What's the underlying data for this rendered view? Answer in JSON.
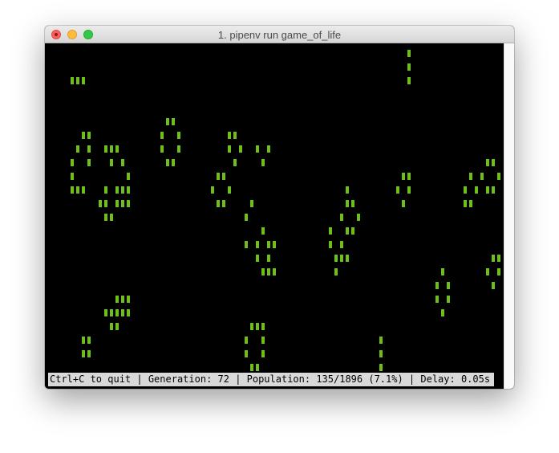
{
  "window": {
    "title": "1. pipenv run game_of_life"
  },
  "status": {
    "text": "Ctrl+C to quit | Generation: 72 | Population: 135/1896 (7.1%) | Delay: 0.05s"
  },
  "colors": {
    "cell": "#6fbf1a",
    "terminal_background": "#000000",
    "status_background": "#d9d9d9"
  },
  "grid": {
    "columns": 79,
    "rows": 24,
    "live_cells": [
      [
        62,
        0
      ],
      [
        62,
        1
      ],
      [
        2,
        2
      ],
      [
        3,
        2
      ],
      [
        4,
        2
      ],
      [
        62,
        2
      ],
      [
        19,
        5
      ],
      [
        20,
        5
      ],
      [
        4,
        6
      ],
      [
        5,
        6
      ],
      [
        18,
        6
      ],
      [
        21,
        6
      ],
      [
        30,
        6
      ],
      [
        31,
        6
      ],
      [
        3,
        7
      ],
      [
        5,
        7
      ],
      [
        8,
        7
      ],
      [
        9,
        7
      ],
      [
        10,
        7
      ],
      [
        18,
        7
      ],
      [
        21,
        7
      ],
      [
        30,
        7
      ],
      [
        32,
        7
      ],
      [
        35,
        7
      ],
      [
        37,
        7
      ],
      [
        2,
        8
      ],
      [
        5,
        8
      ],
      [
        9,
        8
      ],
      [
        11,
        8
      ],
      [
        19,
        8
      ],
      [
        20,
        8
      ],
      [
        31,
        8
      ],
      [
        36,
        8
      ],
      [
        76,
        8
      ],
      [
        77,
        8
      ],
      [
        2,
        9
      ],
      [
        12,
        9
      ],
      [
        28,
        9
      ],
      [
        29,
        9
      ],
      [
        61,
        9
      ],
      [
        62,
        9
      ],
      [
        73,
        9
      ],
      [
        75,
        9
      ],
      [
        78,
        9
      ],
      [
        2,
        10
      ],
      [
        3,
        10
      ],
      [
        4,
        10
      ],
      [
        8,
        10
      ],
      [
        10,
        10
      ],
      [
        11,
        10
      ],
      [
        12,
        10
      ],
      [
        27,
        10
      ],
      [
        30,
        10
      ],
      [
        51,
        10
      ],
      [
        60,
        10
      ],
      [
        62,
        10
      ],
      [
        72,
        10
      ],
      [
        74,
        10
      ],
      [
        76,
        10
      ],
      [
        77,
        10
      ],
      [
        7,
        11
      ],
      [
        8,
        11
      ],
      [
        10,
        11
      ],
      [
        11,
        11
      ],
      [
        12,
        11
      ],
      [
        28,
        11
      ],
      [
        29,
        11
      ],
      [
        34,
        11
      ],
      [
        51,
        11
      ],
      [
        52,
        11
      ],
      [
        61,
        11
      ],
      [
        72,
        11
      ],
      [
        73,
        11
      ],
      [
        8,
        12
      ],
      [
        9,
        12
      ],
      [
        33,
        12
      ],
      [
        50,
        12
      ],
      [
        53,
        12
      ],
      [
        36,
        13
      ],
      [
        48,
        13
      ],
      [
        51,
        13
      ],
      [
        52,
        13
      ],
      [
        33,
        14
      ],
      [
        35,
        14
      ],
      [
        37,
        14
      ],
      [
        38,
        14
      ],
      [
        48,
        14
      ],
      [
        50,
        14
      ],
      [
        35,
        15
      ],
      [
        37,
        15
      ],
      [
        49,
        15
      ],
      [
        50,
        15
      ],
      [
        51,
        15
      ],
      [
        77,
        15
      ],
      [
        78,
        15
      ],
      [
        36,
        16
      ],
      [
        37,
        16
      ],
      [
        38,
        16
      ],
      [
        49,
        16
      ],
      [
        68,
        16
      ],
      [
        76,
        16
      ],
      [
        78,
        16
      ],
      [
        67,
        17
      ],
      [
        69,
        17
      ],
      [
        77,
        17
      ],
      [
        10,
        18
      ],
      [
        11,
        18
      ],
      [
        12,
        18
      ],
      [
        67,
        18
      ],
      [
        69,
        18
      ],
      [
        8,
        19
      ],
      [
        9,
        19
      ],
      [
        10,
        19
      ],
      [
        11,
        19
      ],
      [
        12,
        19
      ],
      [
        68,
        19
      ],
      [
        9,
        20
      ],
      [
        10,
        20
      ],
      [
        34,
        20
      ],
      [
        35,
        20
      ],
      [
        36,
        20
      ],
      [
        4,
        21
      ],
      [
        5,
        21
      ],
      [
        33,
        21
      ],
      [
        36,
        21
      ],
      [
        57,
        21
      ],
      [
        4,
        22
      ],
      [
        5,
        22
      ],
      [
        33,
        22
      ],
      [
        36,
        22
      ],
      [
        57,
        22
      ],
      [
        34,
        23
      ],
      [
        35,
        23
      ],
      [
        57,
        23
      ]
    ]
  }
}
